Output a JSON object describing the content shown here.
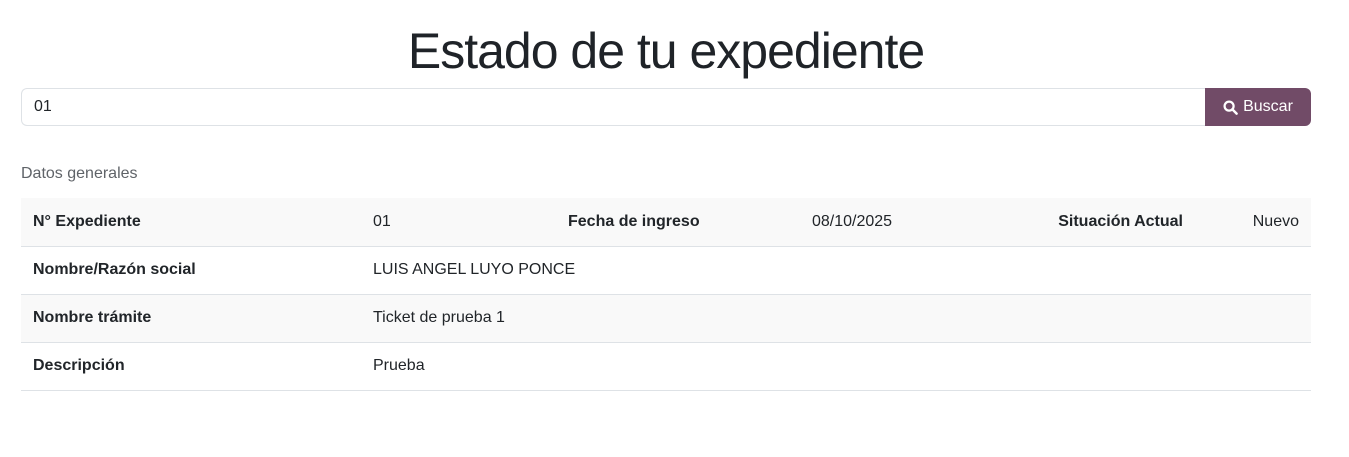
{
  "title": "Estado de tu expediente",
  "search": {
    "value": "01",
    "button_label": "Buscar",
    "icon": "search-icon"
  },
  "section_label": "Datos generales",
  "details": {
    "expediente_label": "N° Expediente",
    "expediente_value": "01",
    "fecha_label": "Fecha de ingreso",
    "fecha_value": "08/10/2025",
    "situacion_label": "Situación Actual",
    "situacion_value": "Nuevo",
    "nombre_label": "Nombre/Razón social",
    "nombre_value": "LUIS ANGEL LUYO PONCE",
    "tramite_label": "Nombre trámite",
    "tramite_value": "Ticket de prueba 1",
    "descripcion_label": "Descripción",
    "descripcion_value": "Prueba"
  },
  "colors": {
    "accent": "#714b67",
    "row_stripe": "#f9f9f9",
    "border": "#dee2e6"
  }
}
